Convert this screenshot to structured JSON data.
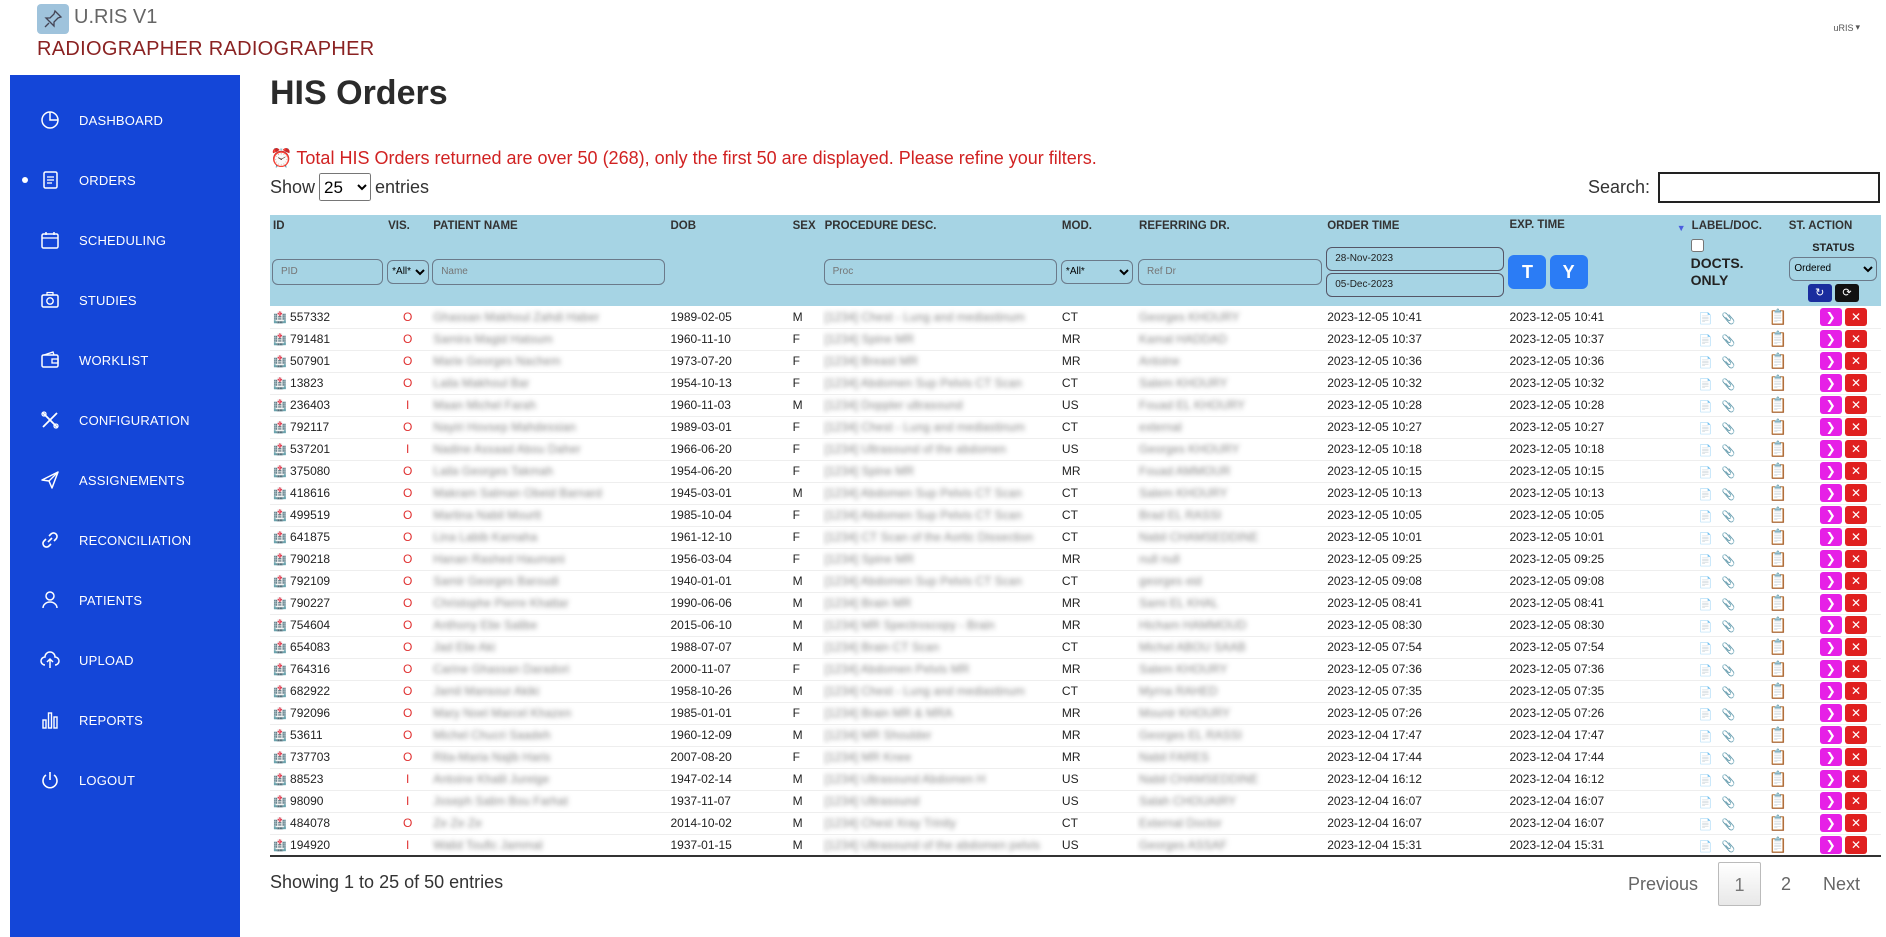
{
  "header": {
    "app_title": "U.RIS V1",
    "user_title": "RADIOGRAPHER RADIOGRAPHER",
    "top_right_logo": "uRIS"
  },
  "sidebar": {
    "items": [
      {
        "label": "DASHBOARD",
        "icon": "pie-chart-icon",
        "active": false
      },
      {
        "label": "ORDERS",
        "icon": "document-icon",
        "active": true
      },
      {
        "label": "SCHEDULING",
        "icon": "calendar-icon",
        "active": false
      },
      {
        "label": "STUDIES",
        "icon": "camera-icon",
        "active": false
      },
      {
        "label": "WORKLIST",
        "icon": "wallet-icon",
        "active": false
      },
      {
        "label": "CONFIGURATION",
        "icon": "tools-icon",
        "active": false
      },
      {
        "label": "ASSIGNEMENTS",
        "icon": "send-icon",
        "active": false
      },
      {
        "label": "RECONCILIATION",
        "icon": "link-icon",
        "active": false
      },
      {
        "label": "PATIENTS",
        "icon": "user-icon",
        "active": false
      },
      {
        "label": "UPLOAD",
        "icon": "cloud-upload-icon",
        "active": false
      },
      {
        "label": "REPORTS",
        "icon": "bar-chart-icon",
        "active": false
      },
      {
        "label": "LOGOUT",
        "icon": "power-icon",
        "active": false
      }
    ]
  },
  "main": {
    "title": "HIS Orders",
    "alert": "Total HIS Orders returned are over 50 (268), only the first 50 are displayed. Please refine your filters.",
    "show_label": "Show",
    "entries_label": "entries",
    "page_size": "25",
    "search_label": "Search:",
    "search_value": ""
  },
  "table": {
    "columns": [
      "ID",
      "VIS.",
      "PATIENT NAME",
      "DOB",
      "SEX",
      "PROCEDURE DESC.",
      "MOD.",
      "REFERRING DR.",
      "ORDER TIME",
      "EXP. TIME",
      "LABEL/DOC.",
      "ST.",
      "ACTION"
    ],
    "filters": {
      "pid_placeholder": "PID",
      "vis_value": "*All*",
      "name_placeholder": "Name",
      "proc_placeholder": "Proc",
      "mod_value": "*All*",
      "ref_placeholder": "Ref Dr",
      "date_from": "28-Nov-2023",
      "date_to": "05-Dec-2023",
      "t_button": "T",
      "y_button": "Y",
      "docts_only": "DOCTS. ONLY",
      "status_label": "STATUS",
      "status_value": "Ordered"
    },
    "rows": [
      {
        "id": "557332",
        "vis": "O",
        "name": "Ghassan Makhoul Zahdi Haber",
        "dob": "1989-02-05",
        "sex": "M",
        "proc": "[1234] Chest - Lung and mediastinum",
        "mod": "CT",
        "ref": "Georges KHOURY",
        "order": "2023-12-05 10:41",
        "exp": "2023-12-05 10:41"
      },
      {
        "id": "791481",
        "vis": "O",
        "name": "Samira Magid Hatoum",
        "dob": "1960-11-10",
        "sex": "F",
        "proc": "[1234] Spine MR",
        "mod": "MR",
        "ref": "Kamal HADDAD",
        "order": "2023-12-05 10:37",
        "exp": "2023-12-05 10:37"
      },
      {
        "id": "507901",
        "vis": "O",
        "name": "Marie Georges Nachem",
        "dob": "1973-07-20",
        "sex": "F",
        "proc": "[1234] Breast MR",
        "mod": "MR",
        "ref": "Antoine",
        "order": "2023-12-05 10:36",
        "exp": "2023-12-05 10:36"
      },
      {
        "id": "13823",
        "vis": "O",
        "name": "Laila Makhoul Bar",
        "dob": "1954-10-13",
        "sex": "F",
        "proc": "[1234] Abdomen Sup Pelvis CT Scan",
        "mod": "CT",
        "ref": "Salem KHOURY",
        "order": "2023-12-05 10:32",
        "exp": "2023-12-05 10:32"
      },
      {
        "id": "236403",
        "vis": "I",
        "name": "Maan Michel Farah",
        "dob": "1960-11-03",
        "sex": "M",
        "proc": "[1234] Doppler ultrasound",
        "mod": "US",
        "ref": "Fouad EL KHOURY",
        "order": "2023-12-05 10:28",
        "exp": "2023-12-05 10:28"
      },
      {
        "id": "792117",
        "vis": "O",
        "name": "Nayiri Hovsep Mahdessian",
        "dob": "1989-03-01",
        "sex": "F",
        "proc": "[1234] Chest - Lung and mediastinum",
        "mod": "CT",
        "ref": "external",
        "order": "2023-12-05 10:27",
        "exp": "2023-12-05 10:27"
      },
      {
        "id": "537201",
        "vis": "I",
        "name": "Nadine Assaad Abou Daher",
        "dob": "1966-06-20",
        "sex": "F",
        "proc": "[1234] Ultrasound of the abdomen",
        "mod": "US",
        "ref": "Georges KHOURY",
        "order": "2023-12-05 10:18",
        "exp": "2023-12-05 10:18"
      },
      {
        "id": "375080",
        "vis": "O",
        "name": "Laila Georges Takmah",
        "dob": "1954-06-20",
        "sex": "F",
        "proc": "[1234] Spine MR",
        "mod": "MR",
        "ref": "Fouad AMMOUR",
        "order": "2023-12-05 10:15",
        "exp": "2023-12-05 10:15"
      },
      {
        "id": "418616",
        "vis": "O",
        "name": "Makram Salman Obeid Barnard",
        "dob": "1945-03-01",
        "sex": "M",
        "proc": "[1234] Abdomen Sup Pelvis CT Scan",
        "mod": "CT",
        "ref": "Salem KHOURY",
        "order": "2023-12-05 10:13",
        "exp": "2023-12-05 10:13"
      },
      {
        "id": "499519",
        "vis": "O",
        "name": "Martina Nabil Mourtt",
        "dob": "1985-10-04",
        "sex": "F",
        "proc": "[1234] Abdomen Sup Pelvis CT Scan",
        "mod": "CT",
        "ref": "Brad EL RASSI",
        "order": "2023-12-05 10:05",
        "exp": "2023-12-05 10:05"
      },
      {
        "id": "641875",
        "vis": "O",
        "name": "Lina Labib Karnaha",
        "dob": "1961-12-10",
        "sex": "F",
        "proc": "[1234] CT Scan of the Aortic Dissection",
        "mod": "CT",
        "ref": "Nabil CHAMSEDDINE",
        "order": "2023-12-05 10:01",
        "exp": "2023-12-05 10:01"
      },
      {
        "id": "790218",
        "vis": "O",
        "name": "Hanan Rashed Haumani",
        "dob": "1956-03-04",
        "sex": "F",
        "proc": "[1234] Spine MR",
        "mod": "MR",
        "ref": "null null",
        "order": "2023-12-05 09:25",
        "exp": "2023-12-05 09:25"
      },
      {
        "id": "792109",
        "vis": "O",
        "name": "Samir Georges Baroudi",
        "dob": "1940-01-01",
        "sex": "M",
        "proc": "[1234] Abdomen Sup Pelvis CT Scan",
        "mod": "CT",
        "ref": "georges eid",
        "order": "2023-12-05 09:08",
        "exp": "2023-12-05 09:08"
      },
      {
        "id": "790227",
        "vis": "O",
        "name": "Christophe Pierre Khattar",
        "dob": "1990-06-06",
        "sex": "M",
        "proc": "[1234] Brain MR",
        "mod": "MR",
        "ref": "Sami EL KHAL",
        "order": "2023-12-05 08:41",
        "exp": "2023-12-05 08:41"
      },
      {
        "id": "754604",
        "vis": "O",
        "name": "Anthony Elie Salibe",
        "dob": "2015-06-10",
        "sex": "M",
        "proc": "[1234] MR Spectroscopy - Brain",
        "mod": "MR",
        "ref": "Hicham HAMMOUD",
        "order": "2023-12-05 08:30",
        "exp": "2023-12-05 08:30"
      },
      {
        "id": "654083",
        "vis": "O",
        "name": "Jad Elie Aki",
        "dob": "1988-07-07",
        "sex": "M",
        "proc": "[1234] Brain CT Scan",
        "mod": "CT",
        "ref": "Michel ABOU SAAB",
        "order": "2023-12-05 07:54",
        "exp": "2023-12-05 07:54"
      },
      {
        "id": "764316",
        "vis": "O",
        "name": "Carine Ghassan Daradori",
        "dob": "2000-11-07",
        "sex": "F",
        "proc": "[1234] Abdomen Pelvis MR",
        "mod": "MR",
        "ref": "Salem KHOURY",
        "order": "2023-12-05 07:36",
        "exp": "2023-12-05 07:36"
      },
      {
        "id": "682922",
        "vis": "O",
        "name": "Jamil Mansour Akiki",
        "dob": "1958-10-26",
        "sex": "M",
        "proc": "[1234] Chest - Lung and mediastinum",
        "mod": "CT",
        "ref": "Myrna RAHED",
        "order": "2023-12-05 07:35",
        "exp": "2023-12-05 07:35"
      },
      {
        "id": "792096",
        "vis": "O",
        "name": "Mary Noel Marcel Khazen",
        "dob": "1985-01-01",
        "sex": "F",
        "proc": "[1234] Brain MR & MRA",
        "mod": "MR",
        "ref": "Mounir KHOURY",
        "order": "2023-12-05 07:26",
        "exp": "2023-12-05 07:26"
      },
      {
        "id": "53611",
        "vis": "O",
        "name": "Michel Chucri Saadeh",
        "dob": "1960-12-09",
        "sex": "M",
        "proc": "[1234] MR Shoulder",
        "mod": "MR",
        "ref": "Georges EL RASSI",
        "order": "2023-12-04 17:47",
        "exp": "2023-12-04 17:47"
      },
      {
        "id": "737703",
        "vis": "O",
        "name": "Rita-Maria Najib Haris",
        "dob": "2007-08-20",
        "sex": "F",
        "proc": "[1234] MR Knee",
        "mod": "MR",
        "ref": "Nabil FARES",
        "order": "2023-12-04 17:44",
        "exp": "2023-12-04 17:44"
      },
      {
        "id": "88523",
        "vis": "I",
        "name": "Antoine Khalil Jureige",
        "dob": "1947-02-14",
        "sex": "M",
        "proc": "[1234] Ultrasound Abdomen H",
        "mod": "US",
        "ref": "Nabil CHAMSEDDINE",
        "order": "2023-12-04 16:12",
        "exp": "2023-12-04 16:12"
      },
      {
        "id": "98090",
        "vis": "I",
        "name": "Joseph Salim Bou Farhat",
        "dob": "1937-11-07",
        "sex": "M",
        "proc": "[1234] Ultrasound",
        "mod": "US",
        "ref": "Salah CHOUAIRY",
        "order": "2023-12-04 16:07",
        "exp": "2023-12-04 16:07"
      },
      {
        "id": "484078",
        "vis": "O",
        "name": "Ze Ze Ze",
        "dob": "2014-10-02",
        "sex": "M",
        "proc": "[1234] Chest Xray Trinity",
        "mod": "CT",
        "ref": "External Doctor",
        "order": "2023-12-04 16:07",
        "exp": "2023-12-04 16:07"
      },
      {
        "id": "194920",
        "vis": "I",
        "name": "Walid Toufic Jammal",
        "dob": "1937-01-15",
        "sex": "M",
        "proc": "[1234] Ultrasound of the abdomen pelvis",
        "mod": "US",
        "ref": "Georges ASSAF",
        "order": "2023-12-04 15:31",
        "exp": "2023-12-04 15:31"
      }
    ]
  },
  "footer": {
    "showing": "Showing 1 to 25 of 50 entries",
    "prev": "Previous",
    "pages": [
      "1",
      "2"
    ],
    "active_page": "1",
    "next": "Next"
  },
  "colors": {
    "sidebar": "#1446d8",
    "table_header": "#a6d4e4",
    "alert": "#d12222",
    "user_title": "#8a2222",
    "action_arrow": "#e620e6",
    "action_close": "#e02020"
  }
}
